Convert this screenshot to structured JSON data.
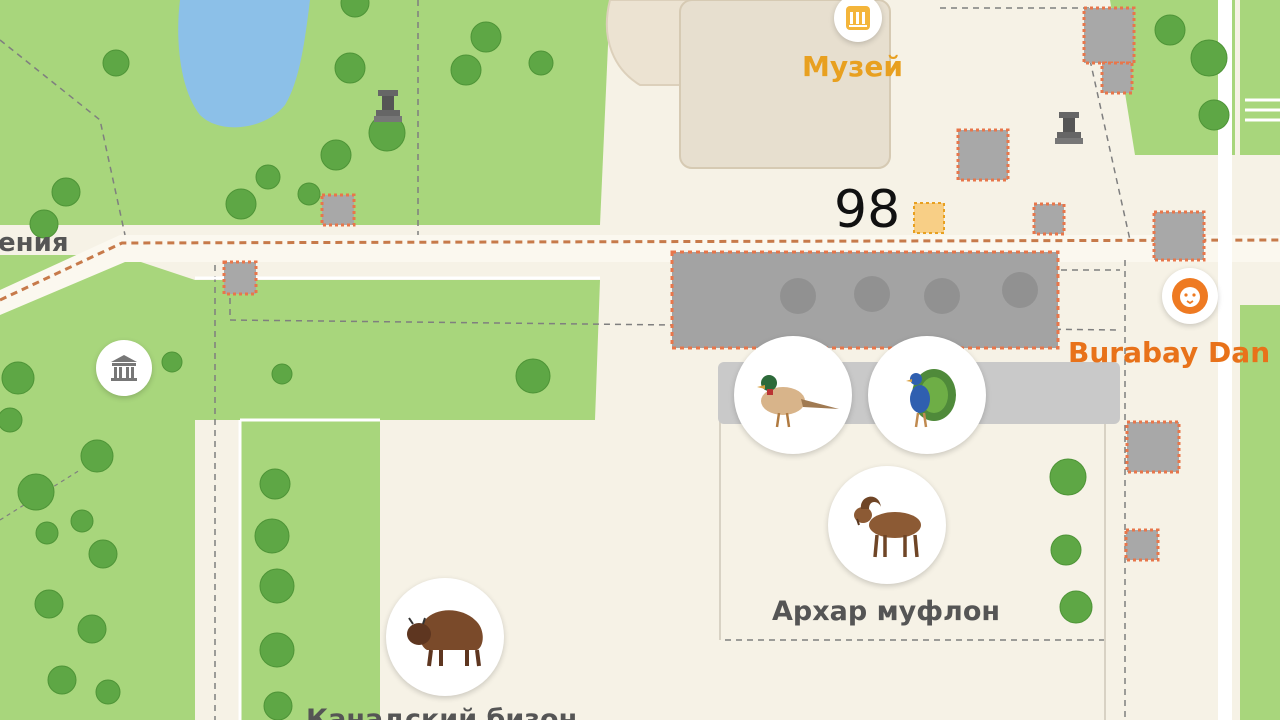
{
  "labels": {
    "museum": "Музей",
    "zoo": "Burabay Dan",
    "road_fragment": "ения",
    "argali": "Архар муфлон",
    "bison": "Канадский бизон",
    "marker_number": "98"
  },
  "icons": {
    "museum": "museum-icon",
    "monument": "monument-icon",
    "theatre": "theatre-icon",
    "zoo": "lion-icon",
    "pheasant": "pheasant-icon",
    "peacock": "peacock-icon",
    "argali": "argali-icon",
    "bison": "bison-icon"
  },
  "colors": {
    "park": "#a8d67c",
    "tree": "#5ea745",
    "water": "#8cc0e8",
    "ground": "#f6f2e6",
    "building": "#e7dfcf",
    "path_dashed": "#c77a4a",
    "label_orange": "#e8a020",
    "zoo_orange": "#e8721a",
    "overlay_gray": "#9e9e9e",
    "overlay_border": "#e8764a"
  }
}
